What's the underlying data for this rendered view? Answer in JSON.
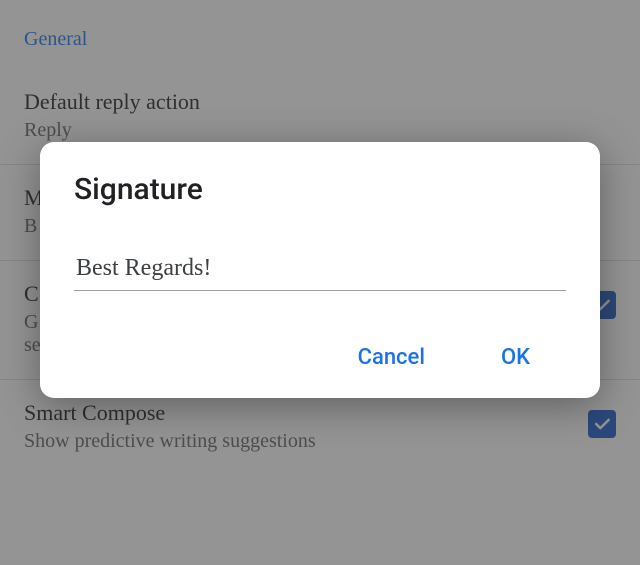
{
  "settings": {
    "section_header": "General",
    "items": [
      {
        "title": "Default reply action",
        "sub": "Reply"
      },
      {
        "title": "M",
        "sub": "B"
      },
      {
        "title": "C",
        "sub": "G\nse"
      },
      {
        "title": "Smart Compose",
        "sub": "Show predictive writing suggestions",
        "checked": true
      }
    ]
  },
  "dialog": {
    "title": "Signature",
    "input_value": "Best Regards!",
    "cancel_label": "Cancel",
    "ok_label": "OK"
  }
}
